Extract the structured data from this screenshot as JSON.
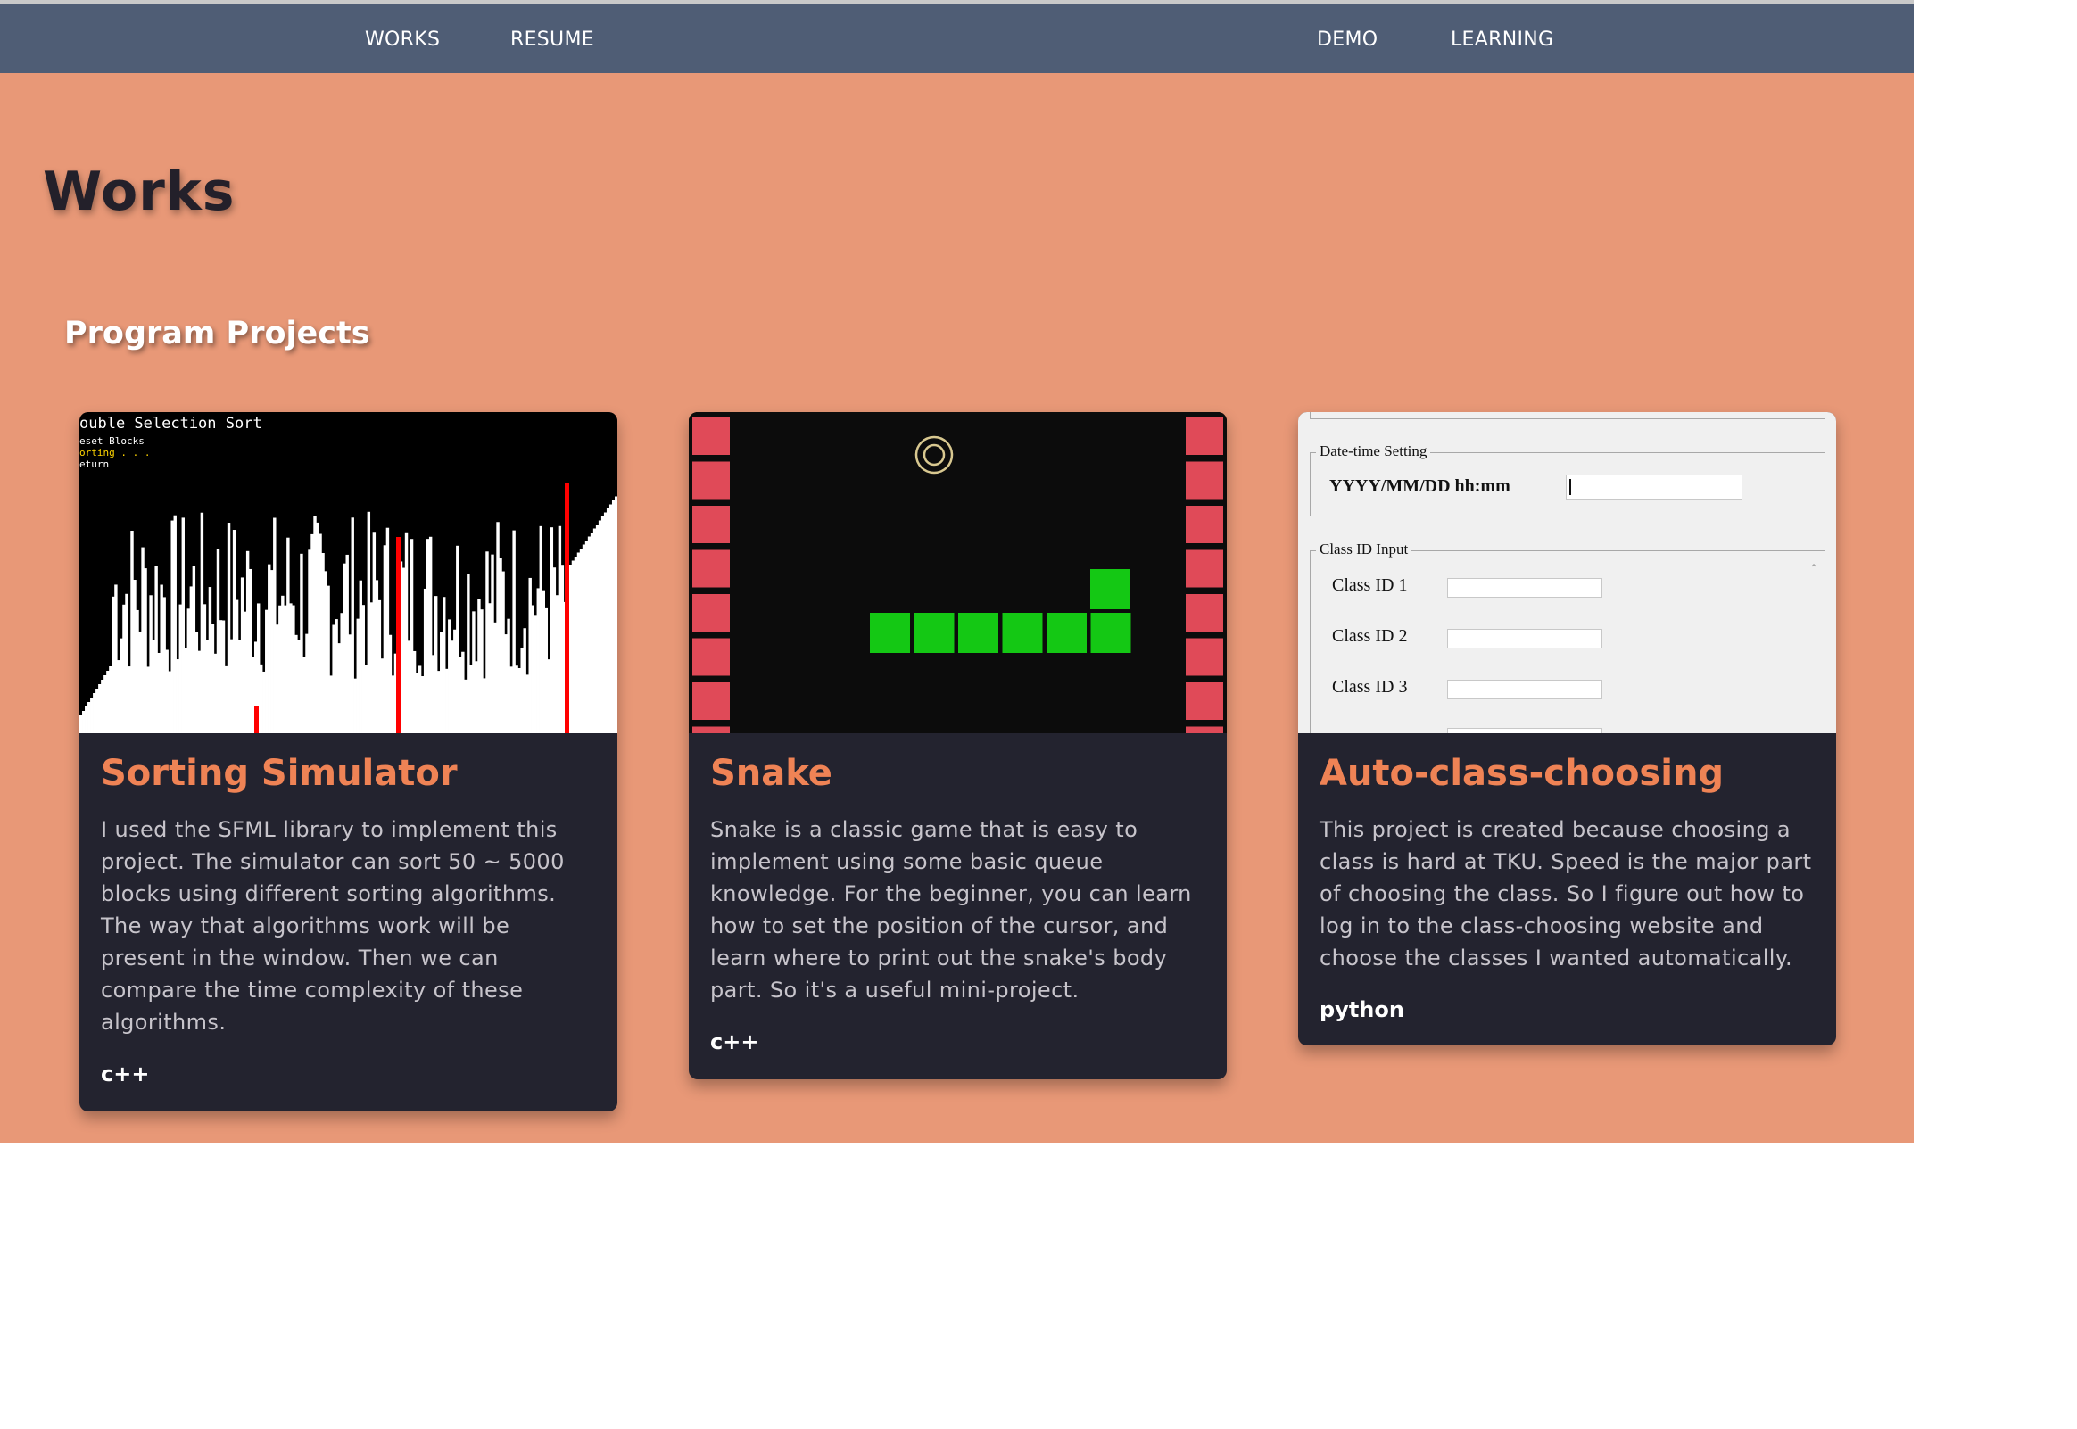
{
  "nav": {
    "items": [
      {
        "label": "WORKS"
      },
      {
        "label": "RESUME"
      },
      {
        "label": "DEMO"
      },
      {
        "label": "LEARNING"
      }
    ]
  },
  "page": {
    "title": "Works",
    "section_title": "Program Projects"
  },
  "cards": [
    {
      "title": "Sorting Simulator",
      "description": "I used the SFML library to implement this project. The simulator can sort 50 ~ 5000 blocks using different sorting algorithms. The way that algorithms work will be present in the window. Then we can compare the time complexity of these algorithms.",
      "tag": "c++",
      "image": {
        "caption": "ouble Selection Sort",
        "menu": [
          "eset Blocks",
          "orting . . .",
          "eturn"
        ]
      }
    },
    {
      "title": "Snake",
      "description": "Snake is a classic game that is easy to implement using some basic queue knowledge. For the beginner, you can learn how to set the position of the cursor, and learn where to print out the snake's body part. So it's a useful mini-project.",
      "tag": "c++"
    },
    {
      "title": "Auto-class-choosing",
      "description": "This project is created because choosing a class is hard at TKU. Speed is the major part of choosing the class. So I figure out how to log in to the class-choosing website and choose the classes I wanted automatically.",
      "tag": "python",
      "image": {
        "datetime_group": "Date-time Setting",
        "datetime_label": "YYYY/MM/DD hh:mm",
        "classid_group": "Class ID Input",
        "class_labels": [
          "Class ID 1",
          "Class ID 2",
          "Class ID 3"
        ]
      }
    }
  ],
  "colors": {
    "navbar": "#4f5d75",
    "background": "#e89877",
    "card": "#23232f",
    "card_title": "#ef8355",
    "snake_body": "#14c814",
    "snake_wall": "#e04a58",
    "sort_highlight": "#ff0000"
  }
}
